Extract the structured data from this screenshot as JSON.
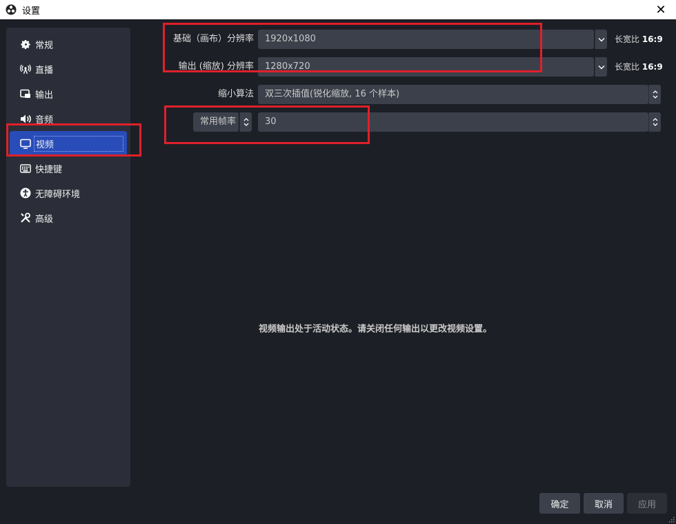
{
  "window": {
    "title": "设置",
    "close": "✕"
  },
  "sidebar": {
    "items": [
      {
        "label": "常规",
        "icon": "gear-icon"
      },
      {
        "label": "直播",
        "icon": "broadcast-icon"
      },
      {
        "label": "输出",
        "icon": "output-icon"
      },
      {
        "label": "音频",
        "icon": "speaker-icon"
      },
      {
        "label": "视频",
        "icon": "monitor-icon",
        "active": true
      },
      {
        "label": "快捷键",
        "icon": "keyboard-icon"
      },
      {
        "label": "无障碍环境",
        "icon": "accessibility-icon"
      },
      {
        "label": "高级",
        "icon": "tools-icon"
      }
    ]
  },
  "video": {
    "base_label": "基础（画布）分辨率",
    "base_value": "1920x1080",
    "base_aspect_label": "长宽比",
    "base_aspect_value": "16:9",
    "output_label": "输出 (缩放) 分辨率",
    "output_value": "1280x720",
    "output_aspect_label": "长宽比",
    "output_aspect_value": "16:9",
    "downscale_label": "缩小算法",
    "downscale_value": "双三次插值(锐化缩放, 16 个样本)",
    "fps_type_value": "常用帧率",
    "fps_value": "30",
    "message": "视频输出处于活动状态。请关闭任何输出以更改视频设置。"
  },
  "buttons": {
    "ok": "确定",
    "cancel": "取消",
    "apply": "应用"
  },
  "colors": {
    "accent": "#284cb8",
    "highlight": "#e0202a"
  }
}
